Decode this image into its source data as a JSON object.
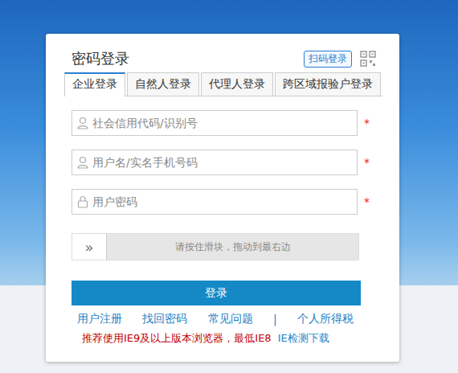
{
  "title": "密码登录",
  "scan_login": "扫码登录",
  "tabs": [
    {
      "label": "企业登录",
      "selected": true
    },
    {
      "label": "自然人登录",
      "selected": false
    },
    {
      "label": "代理人登录",
      "selected": false
    },
    {
      "label": "跨区域报验户登录",
      "selected": false
    }
  ],
  "fields": [
    {
      "placeholder": "社会信用代码/识别号",
      "kind": "user",
      "required": true
    },
    {
      "placeholder": "用户名/实名手机号码",
      "kind": "user",
      "required": true
    },
    {
      "placeholder": "用户密码",
      "kind": "password",
      "required": true
    }
  ],
  "required_mark": "*",
  "slider": {
    "handle": "»",
    "hint": "请按住滑块，拖动到最右边",
    "level": 0
  },
  "login_button": "登录",
  "links": [
    {
      "label": "用户注册",
      "kind": "link"
    },
    {
      "label": "找回密码",
      "kind": "link"
    },
    {
      "label": "常见问题",
      "kind": "link"
    },
    {
      "label": "|",
      "kind": "separator"
    },
    {
      "label": "个人所得税",
      "kind": "link"
    }
  ],
  "notice": {
    "text": "推荐使用IE9及以上版本浏览器，最低IE8",
    "link": "IE检测下载"
  }
}
